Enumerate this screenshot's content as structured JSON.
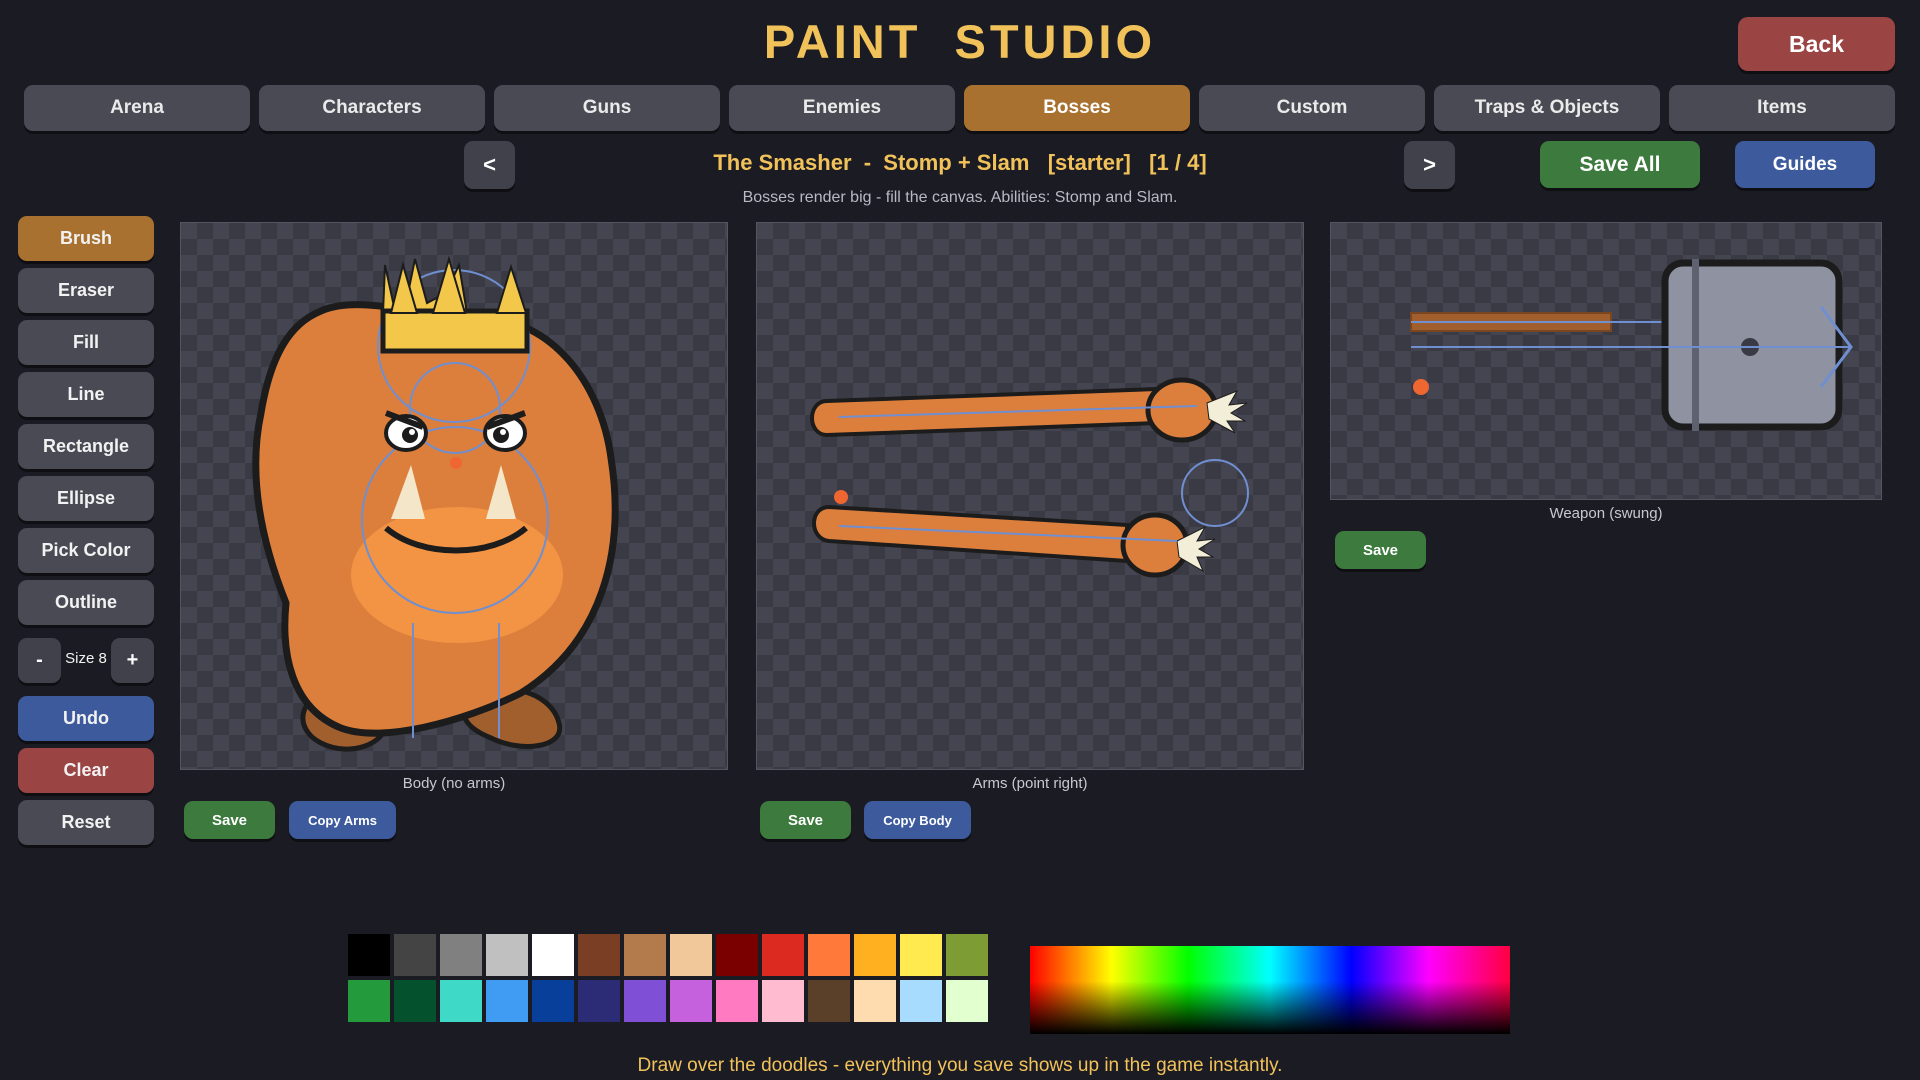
{
  "app_title": "PAINT STUDIO",
  "back_label": "Back",
  "tabs": [
    "Arena",
    "Characters",
    "Guns",
    "Enemies",
    "Bosses",
    "Custom",
    "Traps & Objects",
    "Items"
  ],
  "active_tab": "Bosses",
  "nav": {
    "prev_label": "<",
    "next_label": ">",
    "item_title": "The Smasher  -  Stomp + Slam   [starter]   [1 / 4]",
    "subtitle": "Bosses render big - fill the canvas. Abilities: Stomp and Slam."
  },
  "save_all_label": "Save All",
  "guides_label": "Guides",
  "tools": [
    "Brush",
    "Eraser",
    "Fill",
    "Line",
    "Rectangle",
    "Ellipse",
    "Pick Color",
    "Outline"
  ],
  "active_tool": "Brush",
  "size": {
    "minus": "-",
    "label": "Size 8",
    "plus": "+"
  },
  "actions": {
    "undo": "Undo",
    "clear": "Clear",
    "reset": "Reset"
  },
  "canvases": {
    "body": {
      "caption": "Body (no arms)",
      "save": "Save",
      "copy": "Copy Arms"
    },
    "arms": {
      "caption": "Arms (point right)",
      "save": "Save",
      "copy": "Copy Body"
    },
    "weapon": {
      "caption": "Weapon (swung)",
      "save": "Save"
    }
  },
  "palette": {
    "row1": [
      "#000000",
      "#444444",
      "#808080",
      "#c0c0c0",
      "#ffffff",
      "#7a3e24",
      "#b37b4b",
      "#f0c89a",
      "#7a0000",
      "#dd2a20",
      "#ff7a3a",
      "#ffb020",
      "#ffeb50",
      "#7d9c33"
    ],
    "row2": [
      "#239a3c",
      "#04512e",
      "#3fd9c8",
      "#3f9cf2",
      "#073f9b",
      "#2b2b76",
      "#7f50d6",
      "#c661dd",
      "#ff7ac0",
      "#ffbcd0",
      "#5a4028",
      "#ffdcb0",
      "#a8dcff",
      "#e2ffd0"
    ]
  },
  "footer": "Draw over the doodles - everything you save shows up in the game instantly."
}
